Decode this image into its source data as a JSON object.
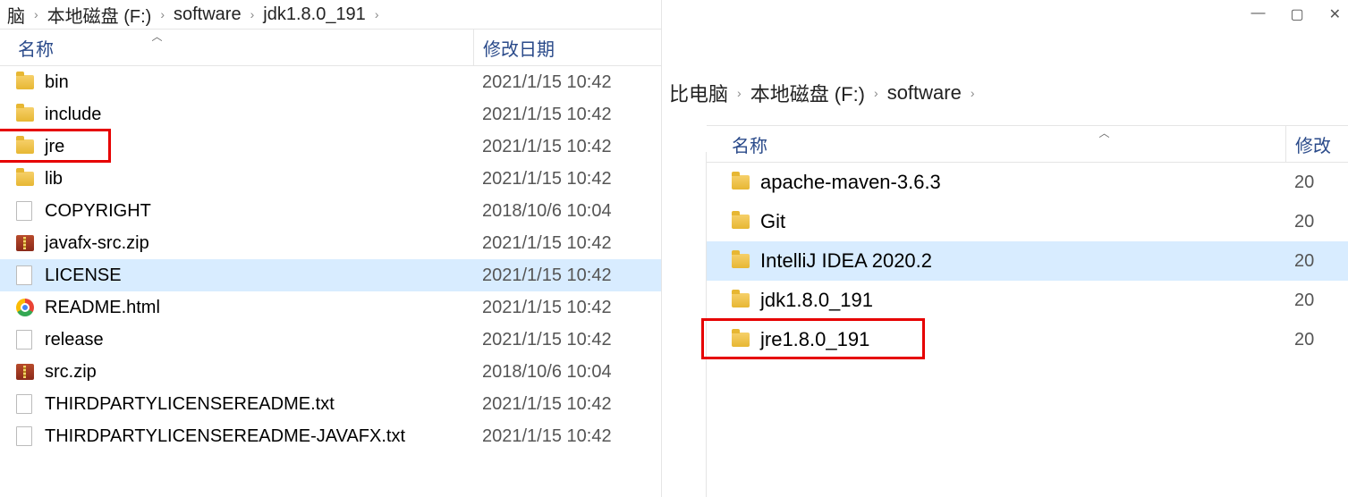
{
  "left": {
    "breadcrumb": [
      "脑",
      "本地磁盘 (F:)",
      "software",
      "jdk1.8.0_191"
    ],
    "columns": {
      "name": "名称",
      "date": "修改日期"
    },
    "items": [
      {
        "icon": "folder",
        "name": "bin",
        "date": "2021/1/15 10:42"
      },
      {
        "icon": "folder",
        "name": "include",
        "date": "2021/1/15 10:42"
      },
      {
        "icon": "folder",
        "name": "jre",
        "date": "2021/1/15 10:42",
        "boxed": true
      },
      {
        "icon": "folder",
        "name": "lib",
        "date": "2021/1/15 10:42"
      },
      {
        "icon": "file",
        "name": "COPYRIGHT",
        "date": "2018/10/6 10:04"
      },
      {
        "icon": "zip",
        "name": "javafx-src.zip",
        "date": "2021/1/15 10:42"
      },
      {
        "icon": "file",
        "name": "LICENSE",
        "date": "2021/1/15 10:42",
        "selected": true
      },
      {
        "icon": "chrome",
        "name": "README.html",
        "date": "2021/1/15 10:42"
      },
      {
        "icon": "file",
        "name": "release",
        "date": "2021/1/15 10:42"
      },
      {
        "icon": "zip",
        "name": "src.zip",
        "date": "2018/10/6 10:04"
      },
      {
        "icon": "file",
        "name": "THIRDPARTYLICENSEREADME.txt",
        "date": "2021/1/15 10:42"
      },
      {
        "icon": "file",
        "name": "THIRDPARTYLICENSEREADME-JAVAFX.txt",
        "date": "2021/1/15 10:42"
      }
    ]
  },
  "right": {
    "breadcrumb": [
      "比电脑",
      "本地磁盘 (F:)",
      "software"
    ],
    "columns": {
      "name": "名称",
      "date": "修改"
    },
    "items": [
      {
        "icon": "folder",
        "name": "apache-maven-3.6.3",
        "date": "20"
      },
      {
        "icon": "folder",
        "name": "Git",
        "date": "20"
      },
      {
        "icon": "folder",
        "name": "IntelliJ IDEA 2020.2",
        "date": "20",
        "selected": true
      },
      {
        "icon": "folder",
        "name": "jdk1.8.0_191",
        "date": "20"
      },
      {
        "icon": "folder",
        "name": "jre1.8.0_191",
        "date": "20",
        "boxed": true
      }
    ]
  }
}
